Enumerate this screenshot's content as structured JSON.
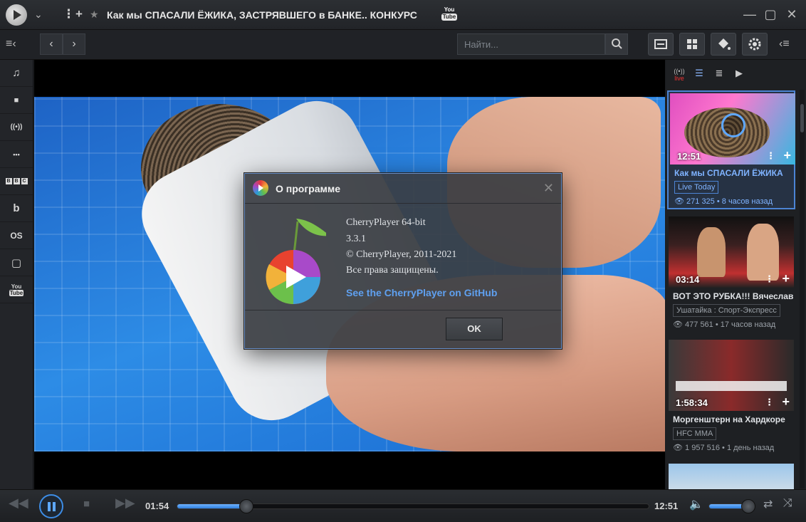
{
  "window": {
    "title": "Как мы СПАСАЛИ ЁЖИКА, ЗАСТРЯВШЕГО в БАНКЕ..  КОНКУРС",
    "source_logo_top": "You",
    "source_logo_bottom": "Tube"
  },
  "toolbar": {
    "search_placeholder": "Найти..."
  },
  "sidebar": {
    "items": [
      {
        "icon": "music-icon",
        "glyph": "♫"
      },
      {
        "icon": "video-camera-icon",
        "glyph": "■"
      },
      {
        "icon": "radio-icon",
        "glyph": "((•))"
      },
      {
        "icon": "more-icon",
        "glyph": "•••"
      },
      {
        "icon": "bbc-icon",
        "letters": [
          "B",
          "B",
          "C"
        ]
      },
      {
        "icon": "bandcamp-icon",
        "glyph": "b"
      },
      {
        "icon": "lastfm-icon",
        "glyph": "OS"
      },
      {
        "icon": "twitch-icon",
        "glyph": "▢"
      },
      {
        "icon": "youtube-icon",
        "glyph_top": "You",
        "glyph_bottom": "Tube"
      }
    ]
  },
  "dialog": {
    "title": "О программе",
    "product": "CherryPlayer 64-bit",
    "version": "3.3.1",
    "copyright": "© CherryPlayer, 2011-2021",
    "rights": "Все права защищены.",
    "link": "See the CherryPlayer on GitHub",
    "ok_label": "OK"
  },
  "playlist": {
    "tabs": [
      "live",
      "",
      "",
      ""
    ],
    "items": [
      {
        "duration": "12:51",
        "title": "Как мы СПАСАЛИ ЁЖИКА",
        "channel": "Live Today",
        "views": "271 325",
        "age": "8 часов назад",
        "active": true
      },
      {
        "duration": "03:14",
        "title": "ВОТ ЭТО РУБКА!!! Вячеслав",
        "channel": "Ушатайка : Спорт-Экспресс",
        "views": "477 561",
        "age": "17 часов назад",
        "active": false
      },
      {
        "duration": "1:58:34",
        "title": "Моргенштерн на Хардкоре",
        "channel": "HFC MMA",
        "views": "1 957 516",
        "age": "1 день назад",
        "active": false
      }
    ]
  },
  "player": {
    "current_time": "01:54",
    "total_time": "12:51",
    "progress": 0.148,
    "volume": 0.9
  },
  "colors": {
    "accent": "#3d8de6",
    "link": "#5fa0f0"
  }
}
